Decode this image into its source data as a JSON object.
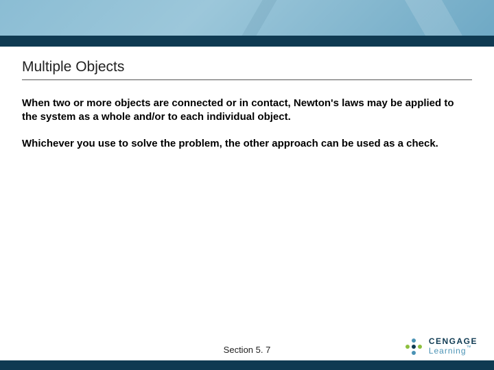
{
  "slide": {
    "title": "Multiple Objects",
    "paragraphs": [
      "When two or more objects are connected or in contact, Newton's laws may be applied to the system as a whole and/or to each individual object.",
      "Whichever you use to solve the problem, the other approach can be used as a check."
    ],
    "section_label": "Section 5. 7"
  },
  "brand": {
    "line1": "CENGAGE",
    "line2": "Learning"
  }
}
